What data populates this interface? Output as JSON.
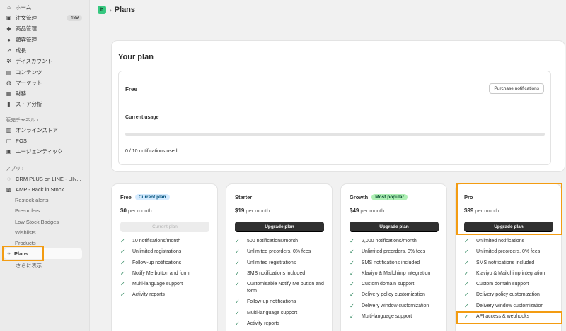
{
  "sidebar": {
    "items": [
      {
        "label": "ホーム",
        "icon": "home-icon",
        "glyph": "⌂"
      },
      {
        "label": "注文管理",
        "icon": "orders-icon",
        "glyph": "▣",
        "badge": "489"
      },
      {
        "label": "商品管理",
        "icon": "tag-icon",
        "glyph": "◆"
      },
      {
        "label": "顧客管理",
        "icon": "person-icon",
        "glyph": "●"
      },
      {
        "label": "成長",
        "icon": "growth-icon",
        "glyph": "↗"
      },
      {
        "label": "ディスカウント",
        "icon": "discount-icon",
        "glyph": "✲"
      },
      {
        "label": "コンテンツ",
        "icon": "content-icon",
        "glyph": "▤"
      },
      {
        "label": "マーケット",
        "icon": "globe-icon",
        "glyph": "◍"
      },
      {
        "label": "財務",
        "icon": "finance-icon",
        "glyph": "▦"
      },
      {
        "label": "ストア分析",
        "icon": "analytics-icon",
        "glyph": "▮"
      }
    ],
    "sales_channels_label": "販売チャネル",
    "channels": [
      {
        "label": "オンラインストア",
        "icon": "store-icon",
        "glyph": "▥"
      },
      {
        "label": "POS",
        "icon": "pos-icon",
        "glyph": "▢"
      },
      {
        "label": "エージェンティック",
        "icon": "agentic-icon",
        "glyph": "▣"
      }
    ],
    "apps_label": "アプリ",
    "apps": [
      {
        "label": "CRM PLUS on LINE - LIN...",
        "icon": "crm-app-icon",
        "glyph": "◌"
      },
      {
        "label": "AMP - Back in Stock",
        "icon": "amp-app-icon",
        "glyph": "▩"
      }
    ],
    "sub_items": [
      "Restock alerts",
      "Pre-orders",
      "Low Stock Badges",
      "Wishlists",
      "Products"
    ],
    "active_item": "Plans",
    "show_more": "さらに表示",
    "chevron": "›"
  },
  "header": {
    "logo_letter": "b",
    "separator": "›",
    "title": "Plans"
  },
  "your_plan": {
    "heading": "Your plan",
    "plan_name": "Free",
    "purchase_button": "Purchase notifications",
    "usage_label": "Current usage",
    "usage_text": "0 / 10 notifications used",
    "usage_fraction": 0
  },
  "plans": [
    {
      "name": "Free",
      "tag": "Current plan",
      "tag_color": "blue",
      "price": "$0",
      "period": "per month",
      "button": "Current plan",
      "button_style": "disabled",
      "features": [
        "10 notifications/month",
        "Unlimited registrations",
        "Follow-up notifications",
        "Notify Me button and form",
        "Multi-language support",
        "Activity reports"
      ]
    },
    {
      "name": "Starter",
      "tag": "",
      "tag_color": "",
      "price": "$19",
      "period": "per month",
      "button": "Upgrade plan",
      "button_style": "dark",
      "features": [
        "500 notifications/month",
        "Unlimited preorders, 0% fees",
        "Unlimited registrations",
        "SMS notifications included",
        "Customisable Notify Me button and form",
        "Follow-up notifications",
        "Multi-language support",
        "Activity reports"
      ]
    },
    {
      "name": "Growth",
      "tag": "Most popular",
      "tag_color": "green",
      "price": "$49",
      "period": "per month",
      "button": "Upgrade plan",
      "button_style": "dark",
      "features": [
        "2,000 notifications/month",
        "Unlimited preorders, 0% fees",
        "SMS notifications included",
        "Klaviyo & Mailchimp integration",
        "Custom domain support",
        "Delivery policy customization",
        "Delivery window customization",
        "Multi-language support"
      ]
    },
    {
      "name": "Pro",
      "tag": "",
      "tag_color": "",
      "price": "$99",
      "period": "per month",
      "button": "Upgrade plan",
      "button_style": "dark",
      "features": [
        "Unlimited notifications",
        "Unlimited preorders, 0% fees",
        "SMS notifications included",
        "Klaviyo & Mailchimp integration",
        "Custom domain support",
        "Delivery policy customization",
        "Delivery window customization",
        "API access & webhooks"
      ]
    }
  ],
  "colors": {
    "accent_highlight": "#f39c12",
    "brand_green": "#37c880",
    "check_green": "#29845a"
  }
}
